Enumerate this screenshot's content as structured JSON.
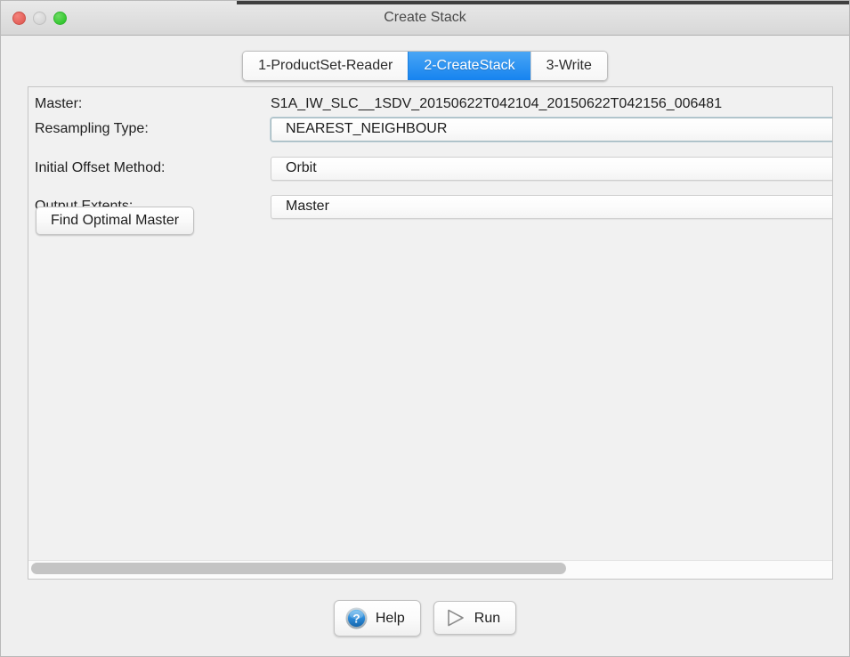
{
  "window": {
    "title": "Create Stack",
    "controls": {
      "close": "close-button",
      "minimize": "minimize-button",
      "maximize": "maximize-button"
    }
  },
  "tabs": [
    {
      "label": "1-ProductSet-Reader",
      "active": false
    },
    {
      "label": "2-CreateStack",
      "active": true
    },
    {
      "label": "3-Write",
      "active": false
    }
  ],
  "form": {
    "master": {
      "label": "Master:",
      "value": "S1A_IW_SLC__1SDV_20150622T042104_20150622T042156_006481"
    },
    "resampling_type": {
      "label": "Resampling Type:",
      "value": "NEAREST_NEIGHBOUR"
    },
    "initial_offset_method": {
      "label": "Initial Offset Method:",
      "value": "Orbit"
    },
    "output_extents": {
      "label": "Output Extents:",
      "value": "Master"
    },
    "find_optimal_master_button": "Find Optimal Master"
  },
  "scrollbar": {
    "thumb_percent": 67
  },
  "footer": {
    "help_label": "Help",
    "run_label": "Run"
  },
  "colors": {
    "active_tab": "#1683ef",
    "window_background": "#ececec",
    "panel_background": "#f1f1f1",
    "help_icon": "#2b8ad8"
  }
}
